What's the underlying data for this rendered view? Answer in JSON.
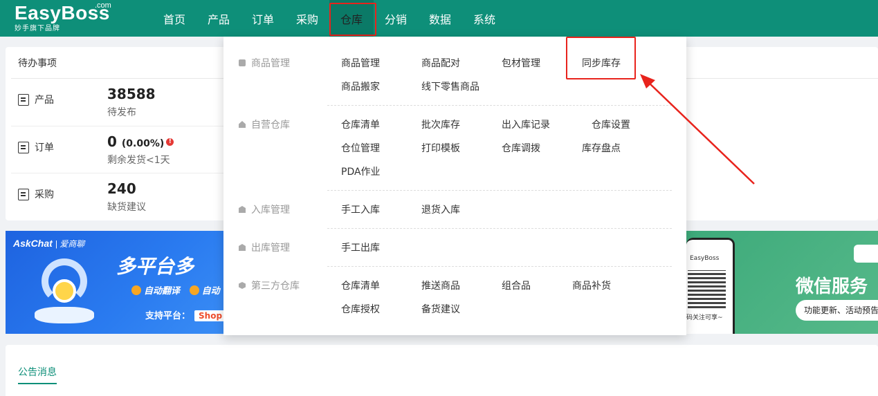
{
  "brand": {
    "name": "EasyBoss",
    "suffix": ".com",
    "tagline": "妙手旗下品牌"
  },
  "nav": [
    "首页",
    "产品",
    "订单",
    "采购",
    "仓库",
    "分销",
    "数据",
    "系统"
  ],
  "nav_active": "仓库",
  "todo": {
    "title": "待办事项",
    "rows": [
      {
        "label": "产品",
        "value": "38588",
        "sub": "待发布"
      },
      {
        "label": "订单",
        "value": "0",
        "pct": "(0.00%)",
        "warn": "!",
        "sub": "剩余发货<1天"
      },
      {
        "label": "采购",
        "value": "240",
        "sub": "缺货建议"
      }
    ]
  },
  "banner_left": {
    "logo": "AskChat",
    "logo_cn": "| 爱商聊",
    "title": "多平台多",
    "features": [
      "自动翻译",
      "自动"
    ],
    "platform_label": "支持平台：",
    "platform_chip": "Shop"
  },
  "banner_right": {
    "phone_brand": "EasyBoss",
    "qr_caption": "码关注可享~",
    "title": "微信服务",
    "pill": "功能更新、活动预告"
  },
  "notice": {
    "tab": "公告消息"
  },
  "dropdown": {
    "groups": [
      {
        "label": "商品管理",
        "items": [
          "商品管理",
          "商品配对",
          "包材管理",
          "同步库存",
          "商品搬家",
          "线下零售商品"
        ]
      },
      {
        "label": "自营仓库",
        "items": [
          "仓库清单",
          "批次库存",
          "出入库记录",
          "仓库设置",
          "仓位管理",
          "打印模板",
          "仓库调拨",
          "库存盘点",
          "PDA作业"
        ]
      },
      {
        "label": "入库管理",
        "items": [
          "手工入库",
          "退货入库"
        ]
      },
      {
        "label": "出库管理",
        "items": [
          "手工出库"
        ]
      },
      {
        "label": "第三方仓库",
        "items": [
          "仓库清单",
          "推送商品",
          "组合品",
          "商品补货",
          "仓库授权",
          "备货建议"
        ]
      }
    ],
    "highlighted_item": "同步库存"
  },
  "colors": {
    "primary": "#0e8f79",
    "highlight": "#e8231c",
    "warning": "#e53935"
  },
  "icons": {
    "group": "folder-icon",
    "warehouse": "home-icon",
    "inbound": "box-icon",
    "outbound": "box-icon",
    "thirdparty": "hex-icon"
  }
}
